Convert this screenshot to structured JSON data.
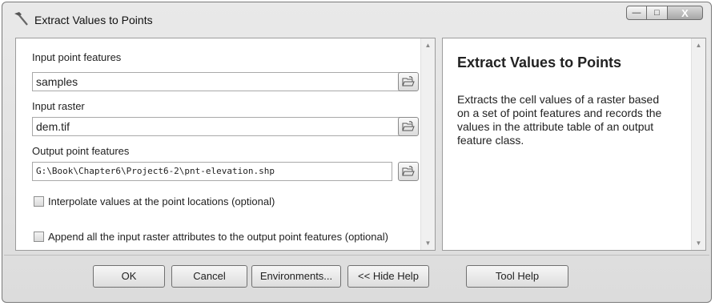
{
  "window": {
    "title": "Extract Values to Points",
    "controls": {
      "minimize": "—",
      "maximize": "□",
      "close": "X"
    }
  },
  "form": {
    "input_points": {
      "label": "Input point features",
      "value": "samples"
    },
    "input_raster": {
      "label": "Input raster",
      "value": "dem.tif"
    },
    "output_points": {
      "label": "Output point features",
      "value": "G:\\Book\\Chapter6\\Project6-2\\pnt-elevation.shp"
    },
    "interpolate": {
      "label": "Interpolate values at the point locations (optional)",
      "checked": false
    },
    "append": {
      "label": "Append all the input raster attributes to the output point features (optional)",
      "checked": false
    }
  },
  "help": {
    "title": "Extract Values to Points",
    "body": "Extracts the cell values of a raster based on a set of point features and records the values in the attribute table of an output feature class."
  },
  "buttons": {
    "ok": "OK",
    "cancel": "Cancel",
    "environments": "Environments...",
    "hide_help": "<< Hide Help",
    "tool_help": "Tool Help"
  }
}
